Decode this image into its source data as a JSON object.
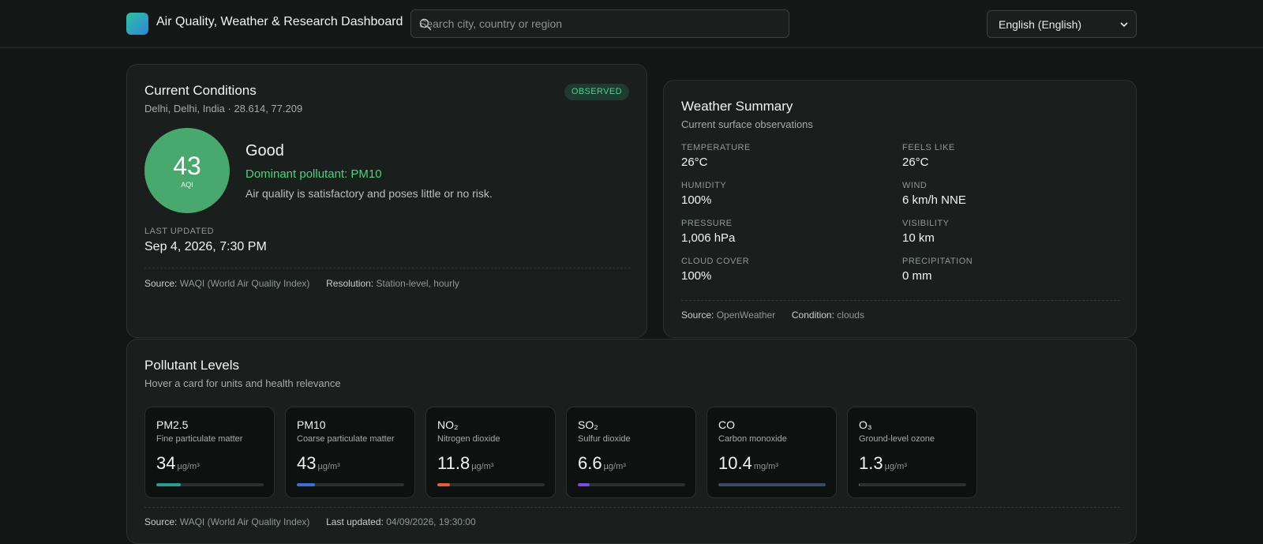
{
  "header": {
    "app_title": "Air Quality, Weather & Research Dashboard",
    "search_placeholder": "Search city, country or region",
    "language": "English (English)"
  },
  "current_conditions": {
    "title": "Current Conditions",
    "location": "Delhi, Delhi, India · 28.614, 77.209",
    "badge": "OBSERVED",
    "aqi_value": "43",
    "aqi_label": "AQI",
    "status": "Good",
    "dominant": "Dominant pollutant: PM10",
    "advice": "Air quality is satisfactory and poses little or no risk.",
    "last_updated_label": "LAST UPDATED",
    "last_updated_value": "Sep 4, 2026, 7:30 PM",
    "source_label": "Source:",
    "source_value": "WAQI (World Air Quality Index)",
    "resolution_label": "Resolution:",
    "resolution_value": "Station-level, hourly",
    "colors": {
      "aqi_good": "#49a86e",
      "badge_text": "#4fcf93"
    }
  },
  "weather_summary": {
    "title": "Weather Summary",
    "subtitle": "Current surface observations",
    "metrics": [
      {
        "label": "TEMPERATURE",
        "value": "26°C"
      },
      {
        "label": "FEELS LIKE",
        "value": "26°C"
      },
      {
        "label": "HUMIDITY",
        "value": "100%"
      },
      {
        "label": "WIND",
        "value": "6 km/h NNE"
      },
      {
        "label": "PRESSURE",
        "value": "1,006 hPa"
      },
      {
        "label": "VISIBILITY",
        "value": "10 km"
      },
      {
        "label": "CLOUD COVER",
        "value": "100%"
      },
      {
        "label": "PRECIPITATION",
        "value": "0 mm"
      }
    ],
    "source_label": "Source:",
    "source_value": "OpenWeather",
    "condition_label": "Condition:",
    "condition_value": "clouds"
  },
  "pollutants": {
    "title": "Pollutant Levels",
    "subtitle": "Hover a card for units and health relevance",
    "items": [
      {
        "name": "PM2.5",
        "desc": "Fine particulate matter",
        "value": "34",
        "unit": "µg/m³",
        "level": 0.23,
        "color": "#2a9d8f"
      },
      {
        "name": "PM10",
        "desc": "Coarse particulate matter",
        "value": "43",
        "unit": "µg/m³",
        "level": 0.17,
        "color": "#3b6fd6"
      },
      {
        "name": "NO₂",
        "desc": "Nitrogen dioxide",
        "value": "11.8",
        "unit": "µg/m³",
        "level": 0.12,
        "color": "#e0622c"
      },
      {
        "name": "SO₂",
        "desc": "Sulfur dioxide",
        "value": "6.6",
        "unit": "µg/m³",
        "level": 0.11,
        "color": "#7b4ce0"
      },
      {
        "name": "CO",
        "desc": "Carbon monoxide",
        "value": "10.4",
        "unit": "mg/m³",
        "level": 1.0,
        "color": "#3a4a66"
      },
      {
        "name": "O₃",
        "desc": "Ground-level ozone",
        "value": "1.3",
        "unit": "µg/m³",
        "level": 0.01,
        "color": "#6a6f6c"
      }
    ],
    "source_label": "Source:",
    "source_value": "WAQI (World Air Quality Index)",
    "updated_label": "Last updated:",
    "updated_value": "04/09/2026, 19:30:00"
  }
}
